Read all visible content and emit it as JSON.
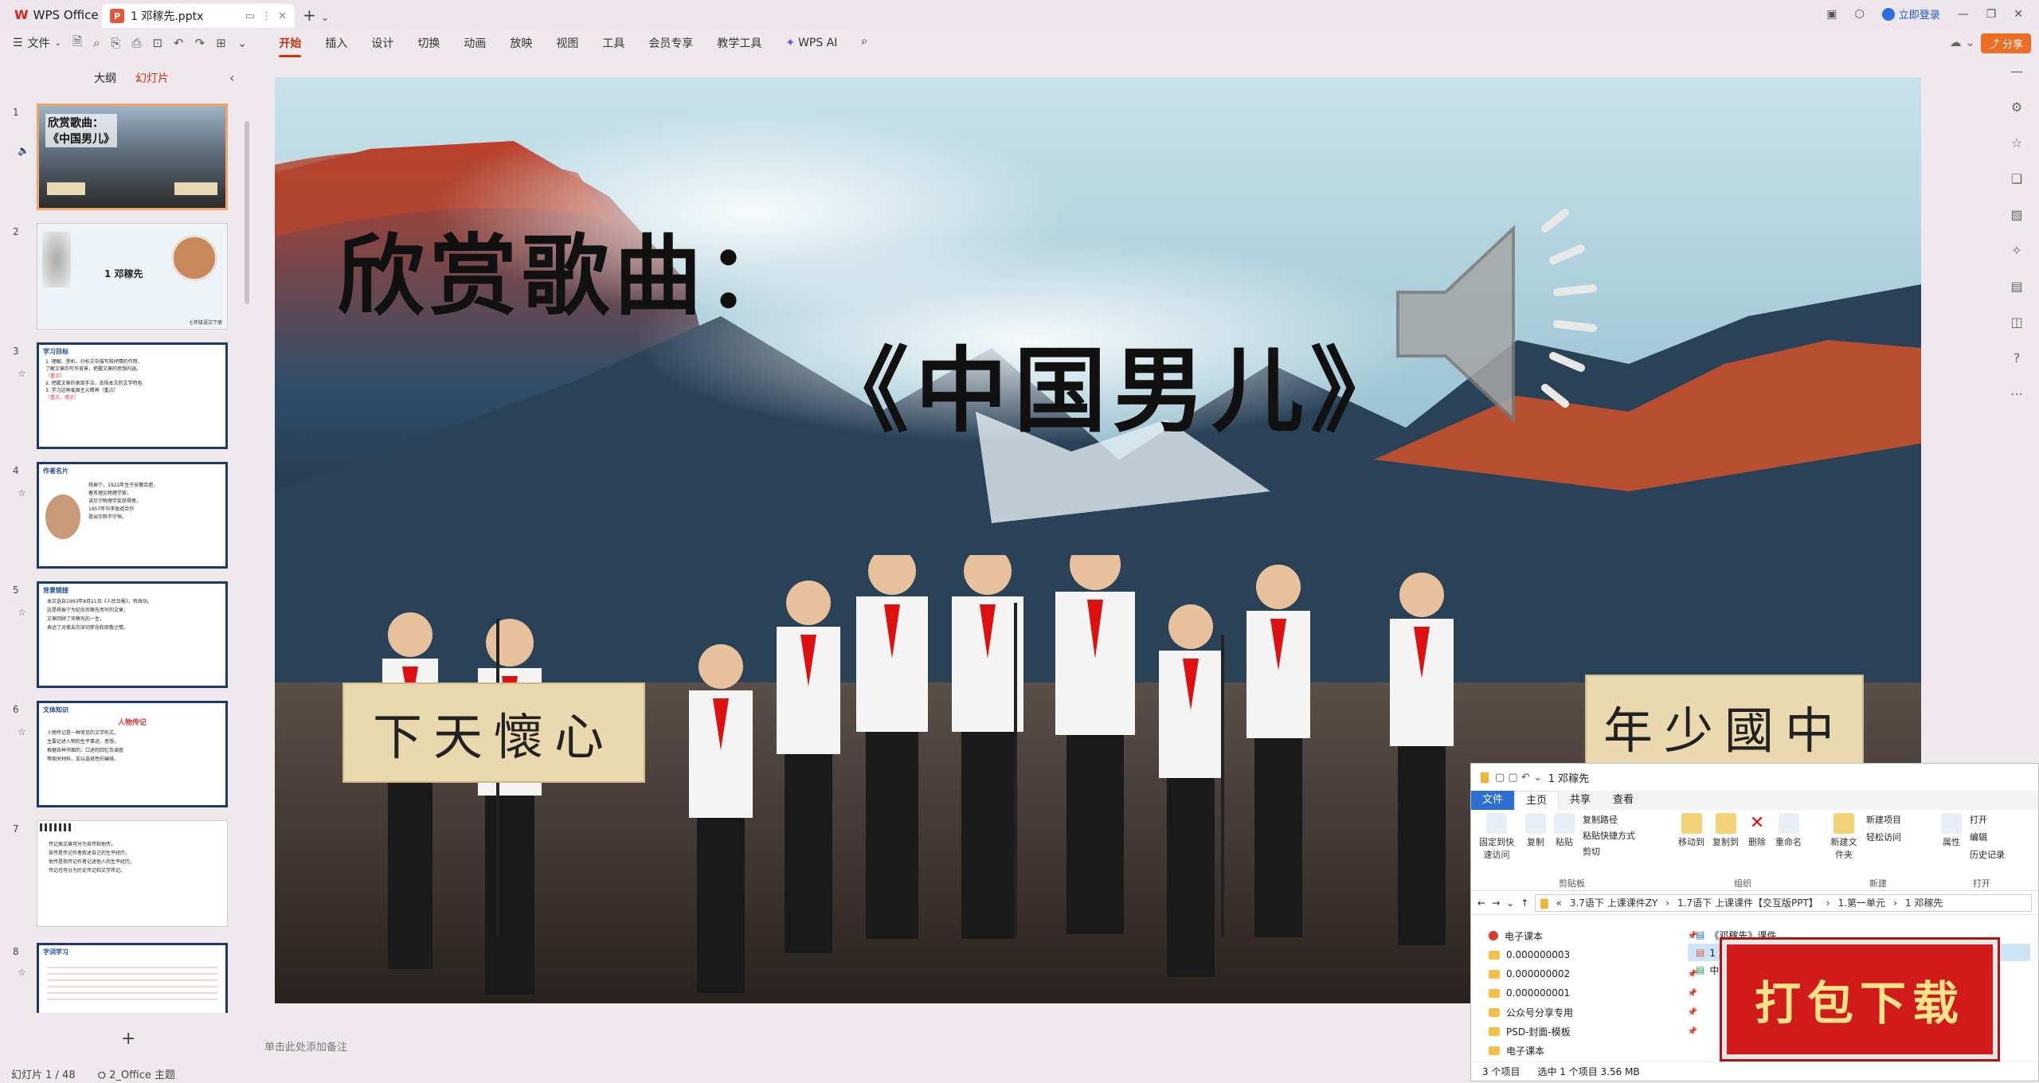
{
  "app": {
    "name": "WPS Office"
  },
  "tab": {
    "filename": "1 邓稼先.pptx"
  },
  "titlebar": {
    "login": "立即登录"
  },
  "ribbon": {
    "file_menu": "文件",
    "tabs": [
      "开始",
      "插入",
      "设计",
      "切换",
      "动画",
      "放映",
      "视图",
      "工具",
      "会员专享",
      "教学工具",
      "WPS AI"
    ],
    "share": "分享"
  },
  "left_panel": {
    "tab_outline": "大纲",
    "tab_slides": "幻灯片",
    "thumbs": [
      {
        "num": "1",
        "title": "欣赏歌曲：《中国男儿》"
      },
      {
        "num": "2",
        "title": "1 邓稼先",
        "sub": "七年级语文下册"
      },
      {
        "num": "3",
        "header": "学习目标",
        "lines": [
          "1. 理解、赏析、分析文中描写和抒情的作用，",
          "了解文章的写作背景，把握文章的思想内涵。",
          "（重点）",
          "2. 把握文章的表现手法，品悟本文的文学特色",
          "3. 学习这种爱国主义精神（重点）"
        ],
        "red": "（重点、难点）"
      },
      {
        "num": "4",
        "header": "作者名片",
        "lines": [
          "杨振宁，1922年生于安徽合肥，",
          "著名理论物理学家，",
          "诺贝尔物理学奖获得者。",
          "1957年与李政道合作",
          "提出宇称不守恒。"
        ]
      },
      {
        "num": "5",
        "header": "背景链接",
        "lines": [
          "本文选自1993年8月21日《人民日报》，有改动。",
          "这是杨振宁为纪念邓稼先而写的文章，",
          "文章回顾了邓稼先的一生，",
          "表达了对挚友的深切怀念和崇敬之情。"
        ]
      },
      {
        "num": "6",
        "header": "文体知识",
        "title": "人物传记",
        "lines": [
          "人物传记是一种常见的文学形式。",
          "主要记述人物的生平事迹、思想，",
          "根据各种书面的、口述的回忆及调查",
          "等相关材料，加以选择性的编排。"
        ]
      },
      {
        "num": "7",
        "lines": [
          "传记类文章可分为自传和他传，",
          "自传是传记作者叙述自己的生平经历，",
          "他传是指传记作者记述他人的生平经历。",
          "传记也可分为历史传记和文学传记。"
        ]
      },
      {
        "num": "8",
        "header": "字词学习"
      }
    ],
    "add": "+"
  },
  "slide": {
    "title_line1": "欣赏歌曲：",
    "title_line2": "《中国男儿》",
    "banner_left": "下天懷心",
    "banner_right": "年少國中"
  },
  "notes": {
    "placeholder": "单击此处添加备注"
  },
  "status": {
    "slide": "幻灯片 1 / 48",
    "theme": "2_Office 主题"
  },
  "explorer": {
    "title": "1 邓稼先",
    "tabs": [
      "文件",
      "主页",
      "共享",
      "查看"
    ],
    "groups": {
      "clipboard_label": "剪贴板",
      "organize_label": "组织",
      "new_label": "新建",
      "open_label": "打开",
      "pin": "固定到快速访问",
      "copy": "复制",
      "paste": "粘贴",
      "copy_path": "复制路径",
      "paste_shortcut": "粘贴快捷方式",
      "cut": "剪切",
      "move_to": "移动到",
      "copy_to": "复制到",
      "delete": "删除",
      "rename": "重命名",
      "new_folder": "新建文件夹",
      "new_item": "新建项目",
      "easy_access": "轻松访问",
      "properties": "属性",
      "open": "打开",
      "edit": "编辑",
      "history": "历史记录"
    },
    "path": [
      "«",
      "3.7语下 上课课件ZY",
      "1.7语下 上课课件【交互版PPT】",
      "1.第一单元",
      "1 邓稼先"
    ],
    "nav": [
      "电子课本",
      "0.000000003",
      "0.000000002",
      "0.000000001",
      "公众号分享专用",
      "PSD-封面-模板",
      "电子课本"
    ],
    "files": [
      "《邓稼先》课件",
      "1 邓稼先",
      "中国男儿"
    ],
    "status_items": "3 个项目",
    "status_selected": "选中 1 个项目  3.56 MB"
  },
  "download_banner": "打包下载"
}
